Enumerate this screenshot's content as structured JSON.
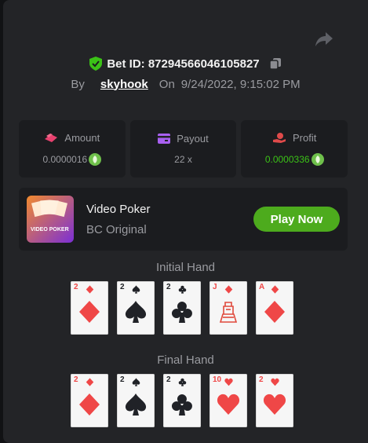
{
  "header": {
    "bet_id_label": "Bet ID: 87294566046105827",
    "by_label": "By",
    "username": "skyhook",
    "on_label": "On",
    "datetime": "9/24/2022, 9:15:02 PM"
  },
  "stats": {
    "amount": {
      "label": "Amount",
      "value": "0.0000016"
    },
    "payout": {
      "label": "Payout",
      "value": "22 x"
    },
    "profit": {
      "label": "Profit",
      "value": "0.0000336"
    }
  },
  "game": {
    "name": "Video Poker",
    "subtitle": "BC Original",
    "thumbnail_text": "VIDEO POKER",
    "play_label": "Play Now"
  },
  "initial_hand": {
    "title": "Initial Hand",
    "cards": [
      {
        "rank": "2",
        "suit": "diamond"
      },
      {
        "rank": "2",
        "suit": "spade"
      },
      {
        "rank": "2",
        "suit": "club"
      },
      {
        "rank": "J",
        "suit": "diamond"
      },
      {
        "rank": "A",
        "suit": "diamond"
      }
    ]
  },
  "final_hand": {
    "title": "Final Hand",
    "cards": [
      {
        "rank": "2",
        "suit": "diamond"
      },
      {
        "rank": "2",
        "suit": "spade"
      },
      {
        "rank": "2",
        "suit": "club"
      },
      {
        "rank": "10",
        "suit": "heart"
      },
      {
        "rank": "2",
        "suit": "heart"
      }
    ]
  },
  "colors": {
    "background": "#232427",
    "tile": "#1b1c1f",
    "accent_green": "#4dab1d",
    "profit_green": "#3bc117",
    "amount_icon": "#e8416f",
    "payout_icon": "#a860f0",
    "profit_icon": "#e04a4a",
    "suit_red": "#ef4747",
    "suit_black": "#202227"
  },
  "icons": {
    "share": "share-arrow-icon",
    "verified": "shield-check-icon",
    "copy": "copy-icon",
    "coin": "leaf-coin-icon"
  }
}
